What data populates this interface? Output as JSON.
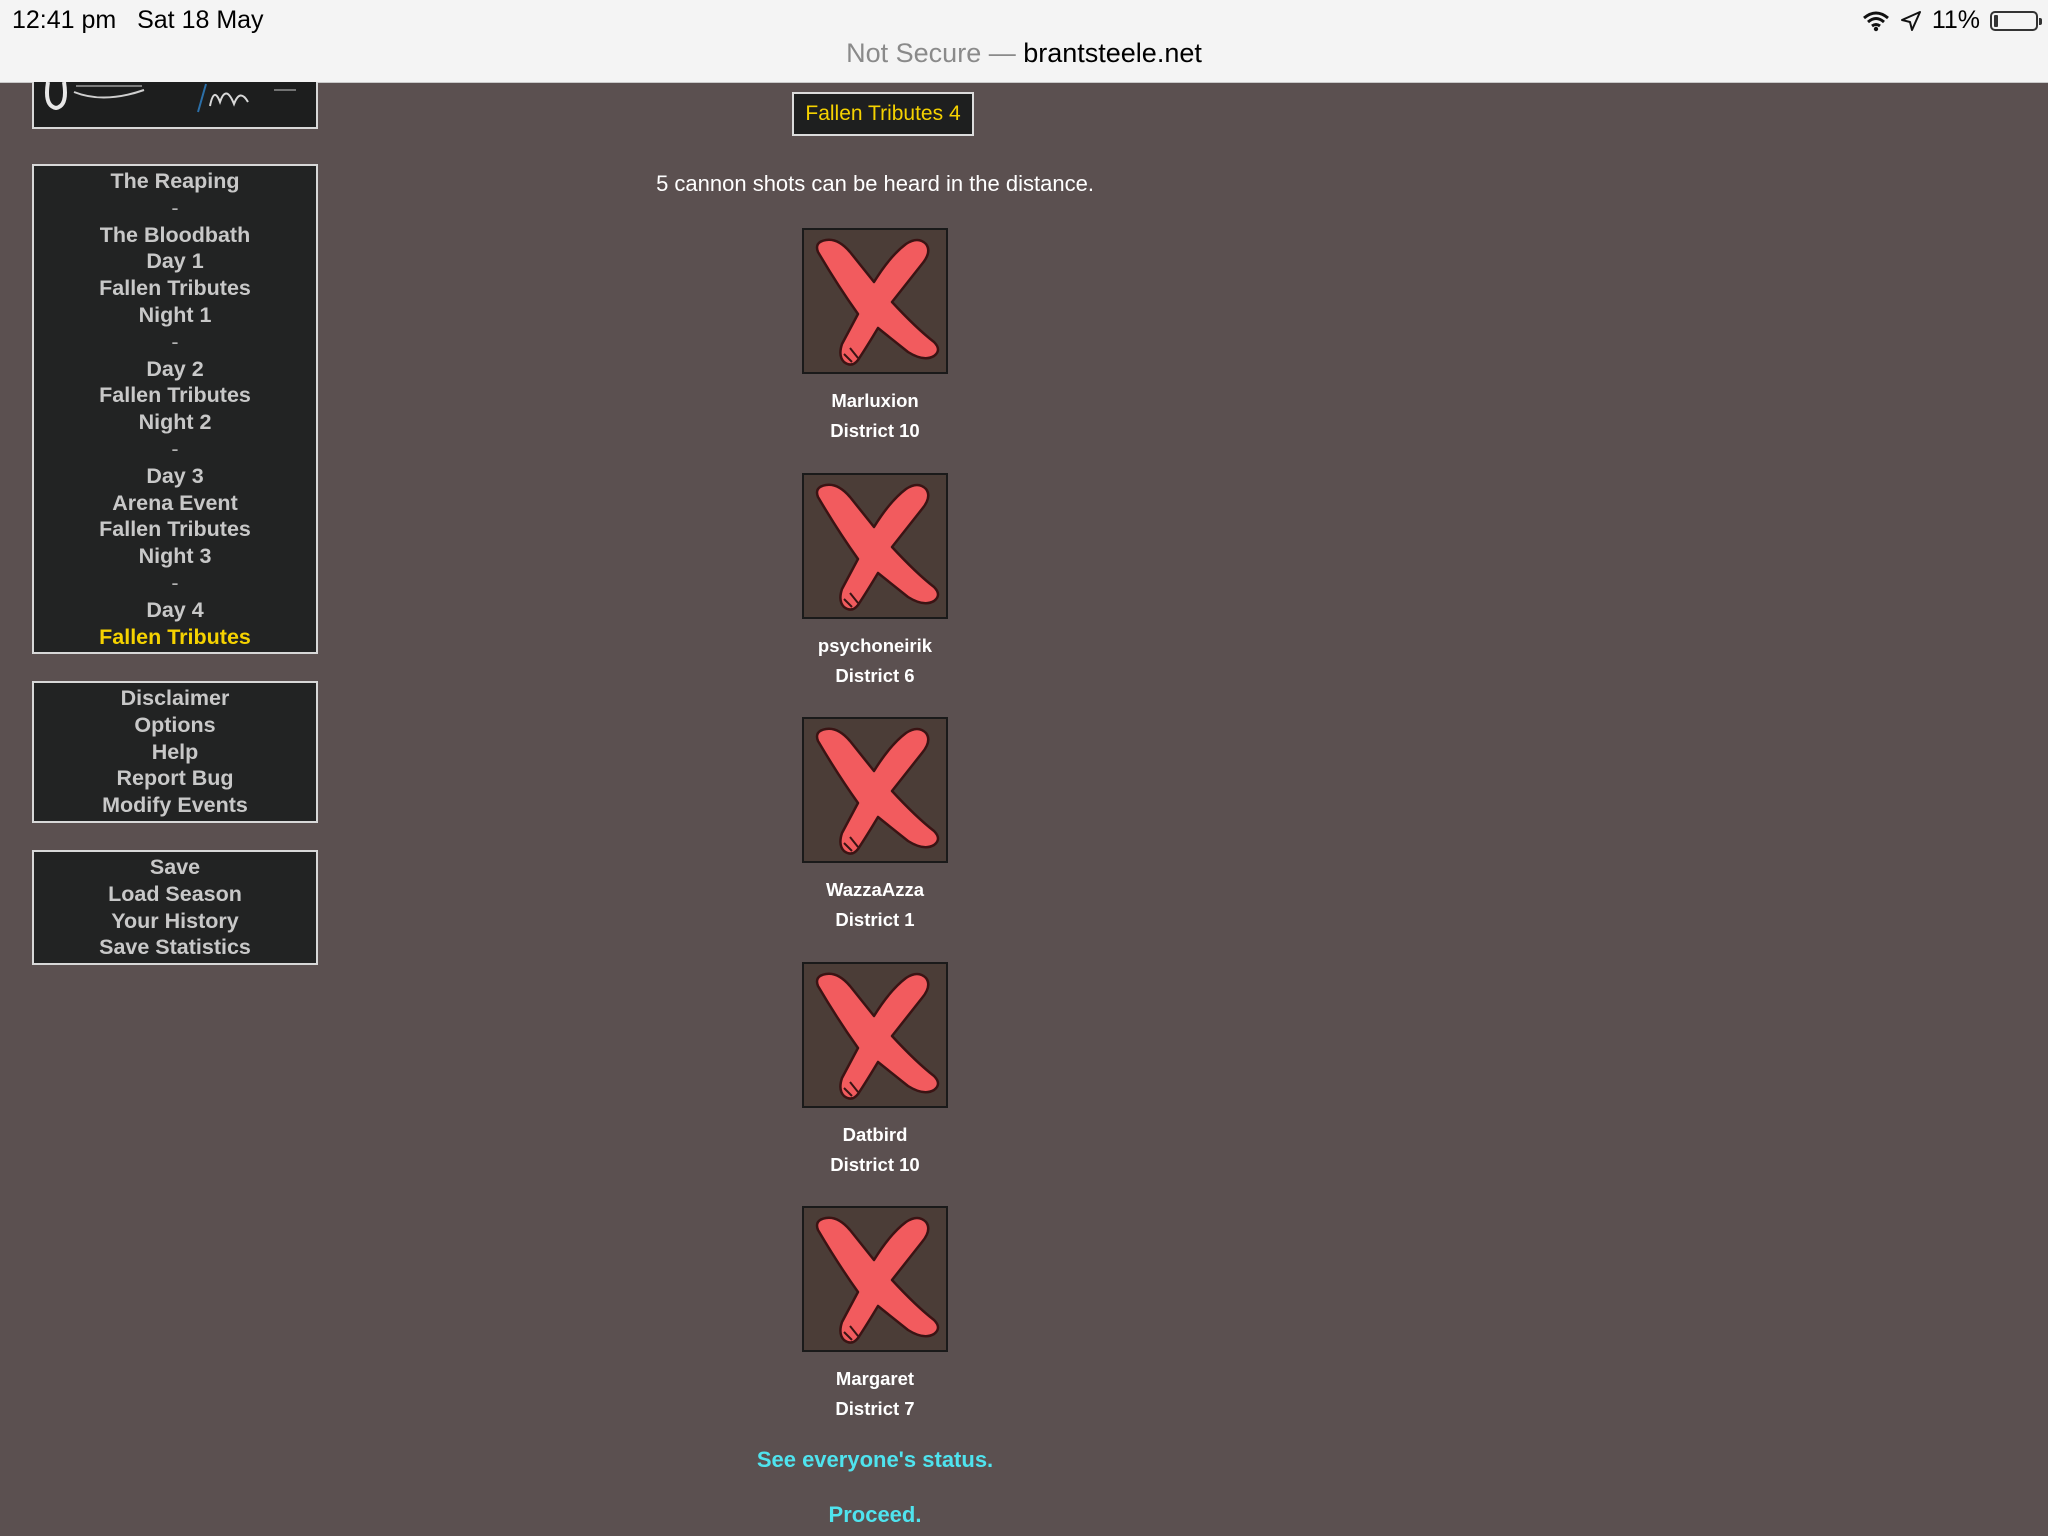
{
  "status_bar": {
    "time": "12:41 pm",
    "date": "Sat 18 May",
    "battery": "11%",
    "battery_level": 0.11,
    "icons": [
      "wifi-icon",
      "location-icon",
      "battery-icon"
    ]
  },
  "address_bar": {
    "security": "Not Secure —",
    "domain": "brantsteele.net"
  },
  "nav_main": [
    {
      "label": "The Reaping"
    },
    {
      "label": "-",
      "sep": true
    },
    {
      "label": "The Bloodbath"
    },
    {
      "label": "Day 1"
    },
    {
      "label": "Fallen Tributes"
    },
    {
      "label": "Night 1"
    },
    {
      "label": "-",
      "sep": true
    },
    {
      "label": "Day 2"
    },
    {
      "label": "Fallen Tributes"
    },
    {
      "label": "Night 2"
    },
    {
      "label": "-",
      "sep": true
    },
    {
      "label": "Day 3"
    },
    {
      "label": "Arena Event"
    },
    {
      "label": "Fallen Tributes"
    },
    {
      "label": "Night 3"
    },
    {
      "label": "-",
      "sep": true
    },
    {
      "label": "Day 4"
    },
    {
      "label": "Fallen Tributes",
      "active": true
    }
  ],
  "nav_info": [
    "Disclaimer",
    "Options",
    "Help",
    "Report Bug",
    "Modify Events"
  ],
  "nav_save": [
    "Save",
    "Load Season",
    "Your History",
    "Save Statistics"
  ],
  "page": {
    "title": "Fallen Tributes 4",
    "message": "5 cannon shots can be heard in the distance."
  },
  "tributes": [
    {
      "name": "Marluxion",
      "district": "District 10"
    },
    {
      "name": "psychoneirik",
      "district": "District 6"
    },
    {
      "name": "WazzaAzza",
      "district": "District 1"
    },
    {
      "name": "Datbird",
      "district": "District 10"
    },
    {
      "name": "Margaret",
      "district": "District 7"
    }
  ],
  "links": {
    "status": "See everyone's status.",
    "proceed": "Proceed."
  },
  "colors": {
    "background": "#5b5050",
    "active_nav": "#f5d200",
    "link": "#4fe3ee",
    "cross": "#f25b5e"
  }
}
